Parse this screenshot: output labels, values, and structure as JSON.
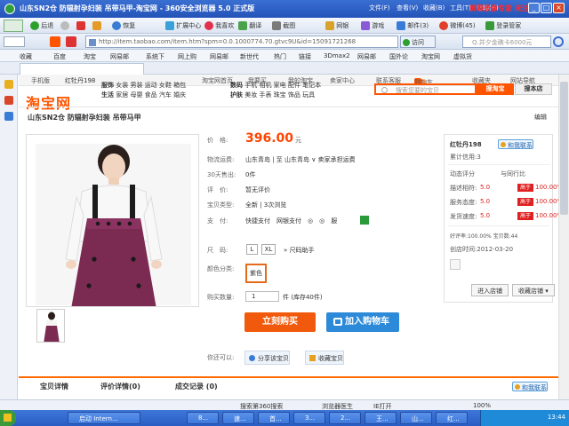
{
  "window": {
    "title": "山东SN2仓 防辐射孕妇装 吊带马甲-淘宝网 - 360安全浏览器 5.0 正式版",
    "menu": [
      "文件(F)",
      "查看(V)",
      "收藏(B)",
      "工具(T)",
      "帮助(H)"
    ],
    "overlay_text": "屏幕录像专家 未注册"
  },
  "toolbar": {
    "back": "后退",
    "restore": "恢复",
    "ext_center": "扩展中心",
    "favorites": "我喜欢",
    "translate": "翻译",
    "screenshot": "截图",
    "netbank": "网银",
    "games": "游戏",
    "mail": "邮件(3)",
    "weibo": "微博(45)",
    "login": "登录管家"
  },
  "address": {
    "url": "http://item.taobao.com/item.htm?spm=0.0.1000774.70.gtvc9U&id=15091721268",
    "go": "访问",
    "search_placeholder": "Q.并夕金礁卡6000元"
  },
  "favbar": {
    "items": [
      "收藏",
      "百度",
      "淘宝",
      "网易邮",
      "系统下",
      "网上购",
      "网易邮",
      "新世代",
      "热门",
      "链接",
      "3Dmax2",
      "网易邮",
      "国外论",
      "淘宝网",
      "虚拟货"
    ]
  },
  "page": {
    "topnav": {
      "mobile": "手机版",
      "user": "红牡丹198",
      "home": "淘宝网首页",
      "i_want_buy": "我要买",
      "my_taobao": "我的淘宝",
      "seller_center": "卖家中心",
      "contact": "联系客服",
      "cart": "购物车",
      "cart_count": "0 件",
      "favorites": "收藏夹",
      "site_nav": "网站导航"
    },
    "logo": "淘宝网",
    "categories": [
      {
        "b": "服饰",
        "r": "女装 男装 运动 女鞋 箱包"
      },
      {
        "b": "生活",
        "r": "家居 母婴 食品 汽车 婚庆"
      },
      {
        "b": "数码",
        "r": "手机 相机 家电 配件 笔记本"
      },
      {
        "b": "护肤",
        "r": "美妆 手表 珠宝 饰品 玩具"
      }
    ],
    "search": {
      "placeholder": "搜索您要的宝贝",
      "button": "搜淘宝",
      "shop_button": "搜本店"
    },
    "product_title": "山东SN2仓 防辐射孕妇装 吊带马甲",
    "edit": "编辑",
    "price_label": "价　格:",
    "price": "396.00",
    "price_unit": "元",
    "shipping_label": "物流运费:",
    "shipping_value": "山东青岛 | 至 山东青岛 ∨ 卖家承担运费",
    "sold_label": "30天售出:",
    "sold_value": "0件",
    "review_label": "评　价:",
    "review_value": "暂无评价",
    "type_label": "宝贝类型:",
    "type_value": "全新 | 3次浏览",
    "pay_label": "支　付:",
    "pay_value": "快捷支付　网银支付　◎　◎　服",
    "size_label": "尺　码:",
    "sizes": [
      "L",
      "XL"
    ],
    "size_help": "尺码助手",
    "color_label": "颜色分类:",
    "color_value": "紫色",
    "qty_label": "购买数量:",
    "qty_value": "1",
    "qty_unit": "件 (库存40件)",
    "buy_now": "立刻购买",
    "add_cart": "加入购物车",
    "you_may_label": "你还可以:",
    "share": "分享该宝贝",
    "collect": "收藏宝贝",
    "shop": {
      "seller": "红牡丹198",
      "wangwang": "和我联系",
      "credit": "累计信用:3",
      "dynamic_title": "动态评分",
      "compare_title": "与同行比",
      "rows": [
        {
          "label": "描述相符:",
          "score": "5.0",
          "tag": "高于",
          "pct": "100.00%"
        },
        {
          "label": "服务态度:",
          "score": "5.0",
          "tag": "高于",
          "pct": "100.00%"
        },
        {
          "label": "发货速度:",
          "score": "5.0",
          "tag": "高于",
          "pct": "100.00%"
        }
      ],
      "good_rate": "好评率:100.00% 宝贝数:44",
      "created": "创店时间:2012-03-20",
      "enter_shop": "进入店铺",
      "fav_shop": "收藏店铺"
    },
    "detail_tabs": [
      "宝贝详情",
      "评价详情(0)",
      "成交记录 (0)"
    ],
    "wangwang_bottom": "和我联系"
  },
  "statusbar": {
    "search_hint": "搜索第360搜索",
    "doctor": "浏览器医生",
    "ie": "IE打开",
    "zoom": "100%"
  },
  "taskbar": {
    "start": "开始",
    "tasks": [
      "启动 Intern...",
      "8...",
      "速...",
      "首...",
      "3...",
      "2...",
      "王...",
      "山...",
      "红...",
      "8...",
      "8..."
    ],
    "time": "13:44"
  }
}
